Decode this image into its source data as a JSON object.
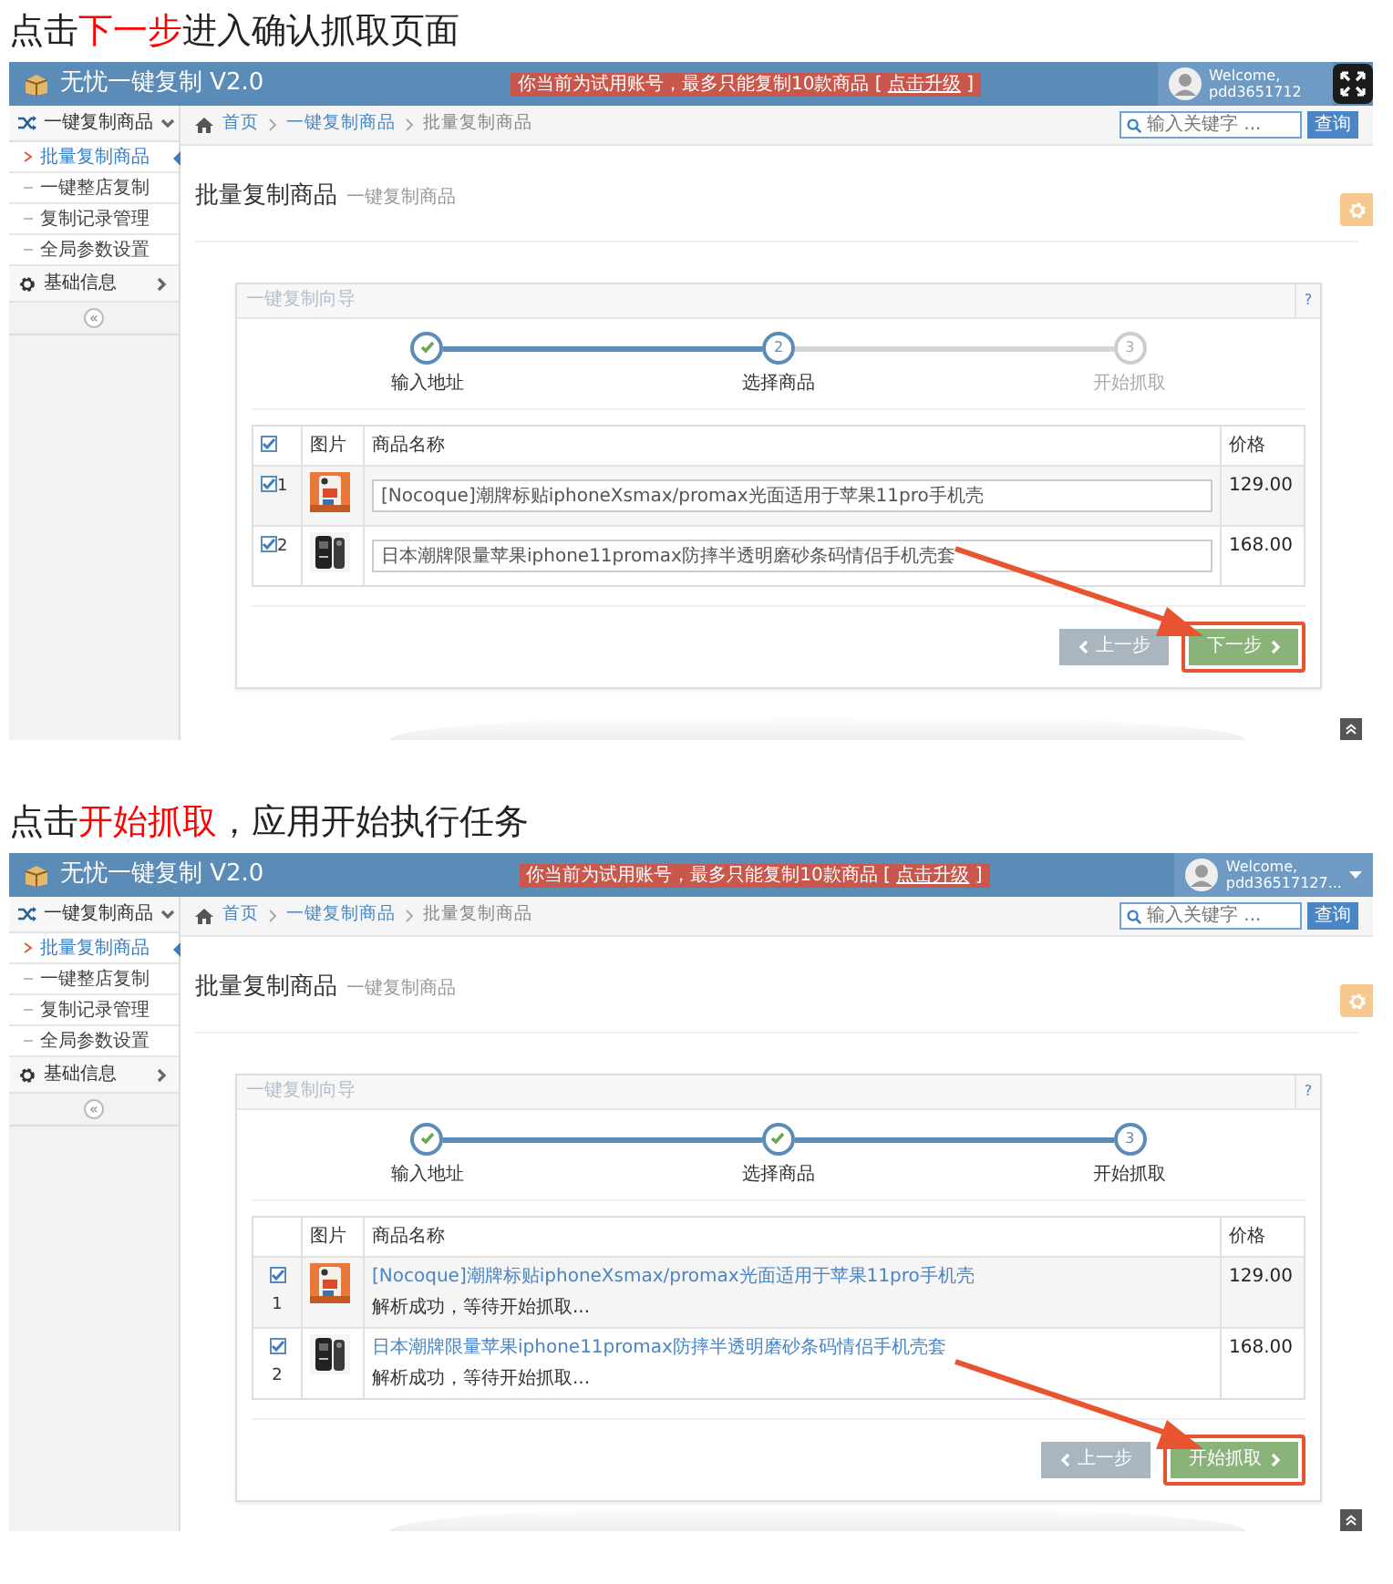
{
  "sections": [
    {
      "heading": [
        {
          "text": "点击",
          "highlight": false
        },
        {
          "text": "下一步",
          "highlight": true
        },
        {
          "text": "进入确认抓取页面",
          "highlight": false
        }
      ],
      "app": {
        "logo": "无忧一键复制 V2.0",
        "notice": {
          "text": "你当前为试用账号，最多只能复制10款商品 [",
          "link": "点击升级",
          "end": "]"
        },
        "user": {
          "welcome": "Welcome,",
          "name": "pdd3651712"
        },
        "fullscreen_button": true,
        "sidebar": [
          {
            "label": "一键复制商品",
            "kind": "shuffle",
            "expanded": true,
            "children": [
              {
                "label": "批量复制商品",
                "selected": true
              },
              {
                "label": "一键整店复制",
                "selected": false
              },
              {
                "label": "复制记录管理",
                "selected": false
              },
              {
                "label": "全局参数设置",
                "selected": false
              }
            ]
          },
          {
            "label": "基础信息",
            "kind": "gear",
            "expanded": false
          }
        ],
        "collapse": "«",
        "breadcrumb": [
          "首页",
          "一键复制商品",
          "批量复制商品"
        ],
        "search": {
          "placeholder": "输入关键字 ...",
          "button": "查询"
        },
        "page_title": "批量复制商品",
        "page_subtitle": "一键复制商品",
        "wizard": {
          "title": "一键复制向导",
          "help": "?",
          "steps": [
            {
              "label": "输入地址",
              "done": true,
              "active": false
            },
            {
              "number": "2",
              "label": "选择商品",
              "done": false,
              "active": true
            },
            {
              "number": "3",
              "label": "开始抓取",
              "done": false,
              "active": false
            }
          ],
          "select_all": {
            "checked": true
          },
          "columns": [
            "图片",
            "商品名称",
            "价格"
          ],
          "rows": [
            {
              "index": "1",
              "checked": true,
              "kind": "editable",
              "name": "[Nocoque]潮牌标贴iphoneXsmax/promax光面适用于苹果11pro手机壳",
              "price": "129.00"
            },
            {
              "index": "2",
              "checked": true,
              "kind": "editable",
              "name": "日本潮牌限量苹果iphone11promax防摔半透明磨砂条码情侣手机壳套",
              "price": "168.00"
            }
          ],
          "buttons": [
            {
              "label": "上一步",
              "kind": "prev",
              "disabled": true,
              "highlighted": false
            },
            {
              "label": "下一步",
              "kind": "next",
              "disabled": false,
              "highlighted": true
            }
          ]
        }
      }
    },
    {
      "heading": [
        {
          "text": "点击",
          "highlight": false
        },
        {
          "text": "开始抓取",
          "highlight": true
        },
        {
          "text": "，应用开始执行任务",
          "highlight": false
        }
      ],
      "app": {
        "logo": "无忧一键复制 V2.0",
        "notice": {
          "text": "你当前为试用账号，最多只能复制10款商品 [",
          "link": "点击升级",
          "end": "]"
        },
        "user": {
          "welcome": "Welcome,",
          "name": "pdd36517127..."
        },
        "fullscreen_button": false,
        "sidebar": [
          {
            "label": "一键复制商品",
            "kind": "shuffle",
            "expanded": true,
            "children": [
              {
                "label": "批量复制商品",
                "selected": true
              },
              {
                "label": "一键整店复制",
                "selected": false
              },
              {
                "label": "复制记录管理",
                "selected": false
              },
              {
                "label": "全局参数设置",
                "selected": false
              }
            ]
          },
          {
            "label": "基础信息",
            "kind": "gear",
            "expanded": false
          }
        ],
        "collapse": "«",
        "breadcrumb": [
          "首页",
          "一键复制商品",
          "批量复制商品"
        ],
        "search": {
          "placeholder": "输入关键字 ...",
          "button": "查询"
        },
        "page_title": "批量复制商品",
        "page_subtitle": "一键复制商品",
        "wizard": {
          "title": "一键复制向导",
          "help": "?",
          "steps": [
            {
              "label": "输入地址",
              "done": true,
              "active": false
            },
            {
              "label": "选择商品",
              "done": true,
              "active": false
            },
            {
              "number": "3",
              "label": "开始抓取",
              "done": false,
              "active": true
            }
          ],
          "columns": [
            "图片",
            "商品名称",
            "价格"
          ],
          "rows": [
            {
              "index": "1",
              "checked": true,
              "kind": "parsed",
              "name": "[Nocoque]潮牌标贴iphoneXsmax/promax光面适用于苹果11pro手机壳",
              "status": "解析成功，等待开始抓取...",
              "price": "129.00"
            },
            {
              "index": "2",
              "checked": true,
              "kind": "parsed",
              "name": "日本潮牌限量苹果iphone11promax防摔半透明磨砂条码情侣手机壳套",
              "status": "解析成功，等待开始抓取...",
              "price": "168.00"
            }
          ],
          "buttons": [
            {
              "label": "上一步",
              "kind": "prev",
              "disabled": true,
              "highlighted": false
            },
            {
              "label": "开始抓取",
              "kind": "next",
              "disabled": false,
              "highlighted": true
            }
          ]
        }
      }
    }
  ]
}
